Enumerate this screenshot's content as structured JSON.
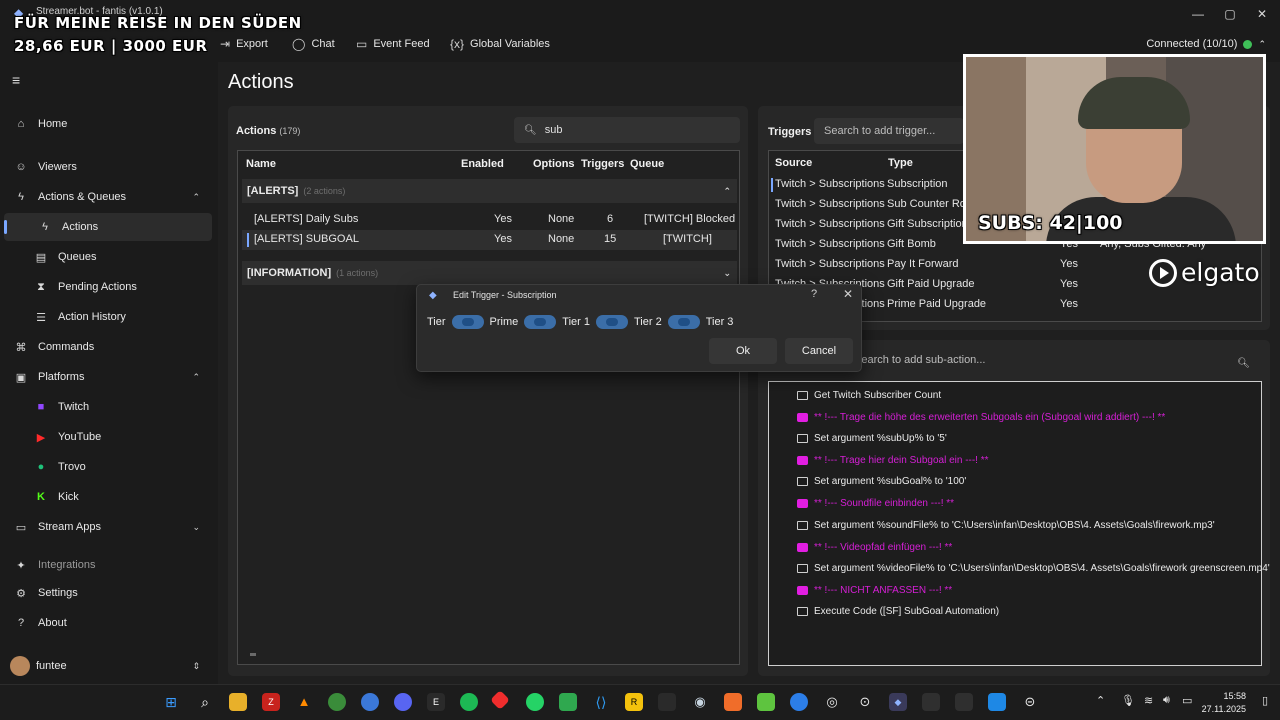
{
  "window": {
    "title": "Streamer.bot - fantis (v1.0.1)",
    "minimize": "—",
    "maximize": "▢",
    "close": "✕"
  },
  "overlay": {
    "line1": "FÜR MEINE REISE IN DEN SÜDEN",
    "line2": "28,66 EUR | 3000 EUR",
    "subs": "SUBS: 42|100",
    "brand": "elgato"
  },
  "toolbar": {
    "export": "Export",
    "chat": "Chat",
    "event_feed": "Event Feed",
    "global_variables": "Global Variables",
    "connected": "Connected (10/10)"
  },
  "sidebar": {
    "home": "Home",
    "viewers": "Viewers",
    "actions_queues": "Actions & Queues",
    "actions": "Actions",
    "queues": "Queues",
    "pending_actions": "Pending Actions",
    "action_history": "Action History",
    "commands": "Commands",
    "platforms": "Platforms",
    "twitch": "Twitch",
    "youtube": "YouTube",
    "trovo": "Trovo",
    "kick": "Kick",
    "stream_apps": "Stream Apps",
    "integrations": "Integrations",
    "settings": "Settings",
    "about": "About",
    "user": "funtee"
  },
  "page_title": "Actions",
  "actions_panel": {
    "title": "Actions",
    "count": "(179)",
    "search_value": "sub",
    "columns": [
      "Name",
      "Enabled",
      "Options",
      "Triggers",
      "Queue"
    ],
    "groups": [
      {
        "name": "[ALERTS]",
        "count": "(2 actions)",
        "rows": [
          {
            "name": "[ALERTS] Daily Subs",
            "enabled": "Yes",
            "options": "None",
            "triggers": "6",
            "queue": "[TWITCH] Blocked"
          },
          {
            "name": "[ALERTS] SUBGOAL",
            "enabled": "Yes",
            "options": "None",
            "triggers": "15",
            "queue": "[TWITCH]"
          }
        ]
      },
      {
        "name": "[INFORMATION]",
        "count": "(1 actions)"
      }
    ]
  },
  "triggers_panel": {
    "title": "Triggers",
    "search_placeholder": "Search to add trigger...",
    "columns": [
      "Source",
      "Type"
    ],
    "rows": [
      {
        "source": "Twitch > Subscriptions",
        "type": "Subscription",
        "enabled": "",
        "details": ""
      },
      {
        "source": "Twitch > Subscriptions",
        "type": "Sub Counter Rol",
        "enabled": "",
        "details": ""
      },
      {
        "source": "Twitch > Subscriptions",
        "type": "Gift Subscription",
        "enabled": "",
        "details": ""
      },
      {
        "source": "Twitch > Subscriptions",
        "type": "Gift Bomb",
        "enabled": "Yes",
        "details": "Any, Subs Gifted: Any"
      },
      {
        "source": "Twitch > Subscriptions",
        "type": "Pay It Forward",
        "enabled": "Yes",
        "details": ""
      },
      {
        "source": "Twitch > Subscriptions",
        "type": "Gift Paid Upgrade",
        "enabled": "Yes",
        "details": ""
      },
      {
        "source": "Twitch > Subscriptions",
        "type": "Prime Paid Upgrade",
        "enabled": "Yes",
        "details": ""
      }
    ]
  },
  "subactions_panel": {
    "search_placeholder": "Search to add sub-action...",
    "items": [
      {
        "kind": "normal",
        "text": "Get Twitch Subscriber Count"
      },
      {
        "kind": "comment",
        "text": "** !--- Trage die höhe des erweiterten Subgoals ein (Subgoal wird addiert) ---! **"
      },
      {
        "kind": "normal",
        "text": "Set argument %subUp% to '5'"
      },
      {
        "kind": "comment",
        "text": "** !--- Trage hier dein Subgoal ein ---! **"
      },
      {
        "kind": "normal",
        "text": "Set argument %subGoal% to '100'"
      },
      {
        "kind": "comment",
        "text": "** !--- Soundfile einbinden ---! **"
      },
      {
        "kind": "normal",
        "text": "Set argument %soundFile% to 'C:\\Users\\infan\\Desktop\\OBS\\4. Assets\\Goals\\firework.mp3'"
      },
      {
        "kind": "comment",
        "text": "** !--- Videopfad einfügen ---! **"
      },
      {
        "kind": "normal",
        "text": "Set argument %videoFile% to 'C:\\Users\\infan\\Desktop\\OBS\\4. Assets\\Goals\\firework greenscreen.mp4'"
      },
      {
        "kind": "comment",
        "text": "** !--- NICHT ANFASSEN ---! **"
      },
      {
        "kind": "normal",
        "text": "Execute Code ([SF] SubGoal Automation)"
      }
    ]
  },
  "dialog": {
    "title": "Edit Trigger - Subscription",
    "help": "?",
    "close": "✕",
    "options": [
      "Tier",
      "Prime",
      "Tier 1",
      "Tier 2",
      "Tier 3"
    ],
    "ok": "Ok",
    "cancel": "Cancel"
  },
  "taskbar": {
    "time": "15:58",
    "date": "27.11.2025"
  },
  "colors": {
    "accent": "#7aa7ff",
    "connected": "#3fbf58",
    "comment": "#d61fd6"
  }
}
